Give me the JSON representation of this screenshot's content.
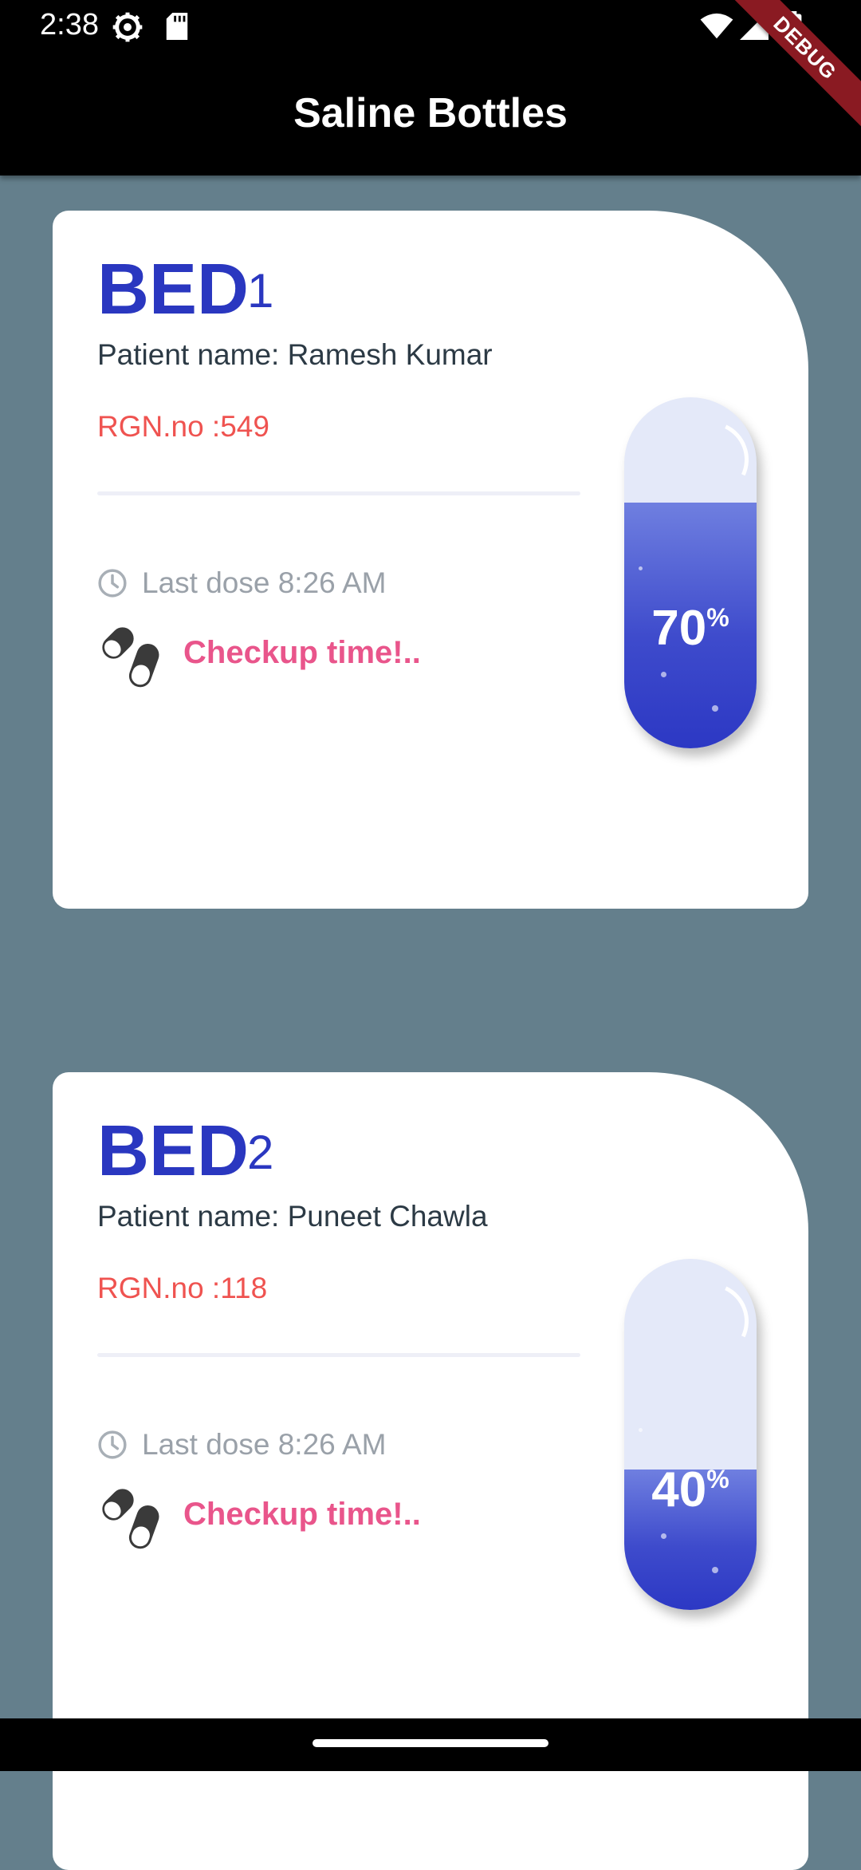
{
  "status_bar": {
    "time": "2:38"
  },
  "app_bar": {
    "title": "Saline Bottles",
    "debug_label": "DEBUG"
  },
  "beds": [
    {
      "bed_word": "BED",
      "bed_number": "1",
      "patient": "Patient name: Ramesh Kumar",
      "rgn": "RGN.no :549",
      "last_dose": "Last dose 8:26 AM",
      "checkup": "Checkup time!..",
      "level_percent": 70,
      "level_label": "70",
      "percent_symbol": "%"
    },
    {
      "bed_word": "BED",
      "bed_number": "2",
      "patient": "Patient name: Puneet Chawla",
      "rgn": "RGN.no :118",
      "last_dose": "Last dose 8:26 AM",
      "checkup": "Checkup time!..",
      "level_percent": 40,
      "level_label": "40",
      "percent_symbol": "%"
    }
  ],
  "colors": {
    "background": "#647f8c",
    "bed_blue": "#2a37c0",
    "rgn_red": "#ef5350",
    "checkup_pink": "#e9558b",
    "liquid": "#3e4bcc"
  }
}
